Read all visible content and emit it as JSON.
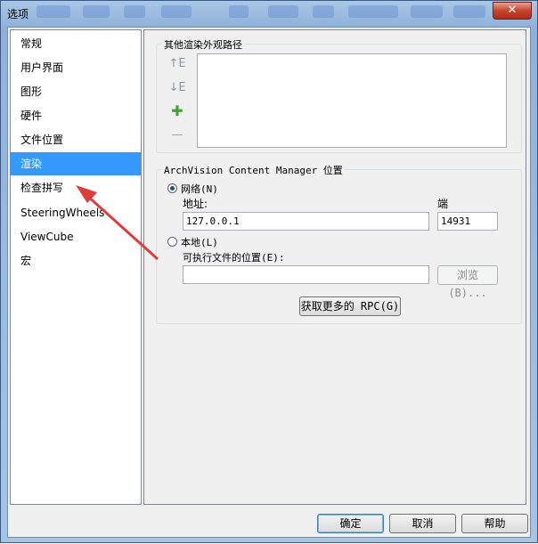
{
  "window": {
    "title": "选项",
    "close_glyph": "✕"
  },
  "sidebar": {
    "items": [
      {
        "label": "常规"
      },
      {
        "label": "用户界面"
      },
      {
        "label": "图形"
      },
      {
        "label": "硬件"
      },
      {
        "label": "文件位置"
      },
      {
        "label": "渲染"
      },
      {
        "label": "检查拼写"
      },
      {
        "label": "SteeringWheels"
      },
      {
        "label": "ViewCube"
      },
      {
        "label": "宏"
      }
    ],
    "selected_index": 5
  },
  "paths_group": {
    "title": "其他渲染外观路径",
    "icons": [
      "move-up-icon",
      "move-down-icon",
      "add-icon",
      "remove-icon"
    ],
    "icon_glyphs": {
      "up": "↑E",
      "down": "↓E",
      "add": "✚",
      "remove": "—"
    },
    "add_color": "#3aa52f"
  },
  "archvision_group": {
    "title": "ArchVision Content Manager 位置",
    "network_label": "网络(N)",
    "address_label": "地址:",
    "address_value": "127.0.0.1",
    "port_label": "端",
    "port_value": "14931",
    "local_label": "本地(L)",
    "exe_label": "可执行文件的位置(E):",
    "exe_value": "",
    "browse_label": "浏览(B)...",
    "get_rpc_label": "获取更多的 RPC(G)",
    "selected": "network"
  },
  "footer": {
    "ok_label": "确定",
    "cancel_label": "取消",
    "help_label": "帮助"
  },
  "colors": {
    "selection": "#3399ff",
    "annotation_arrow": "#e23b3b"
  }
}
